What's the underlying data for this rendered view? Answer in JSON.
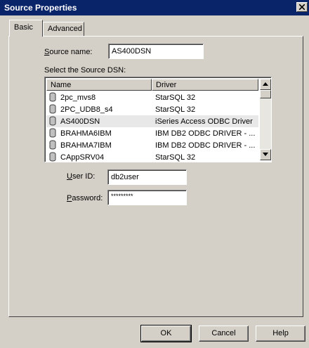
{
  "window": {
    "title": "Source Properties"
  },
  "tabs": [
    {
      "label": "Basic"
    },
    {
      "label": "Advanced"
    }
  ],
  "source_name": {
    "label_pre": "",
    "label_ul": "S",
    "label_post": "ource name:",
    "value": "AS400DSN"
  },
  "dsn_list": {
    "label": "Select the Source DSN:",
    "columns": [
      "Name",
      "Driver"
    ],
    "rows": [
      {
        "name": "2pc_mvs8",
        "driver": "StarSQL 32"
      },
      {
        "name": "2PC_UDB8_s4",
        "driver": "StarSQL 32"
      },
      {
        "name": "AS400DSN",
        "driver": "iSeries Access ODBC Driver"
      },
      {
        "name": "BRAHMA6IBM",
        "driver": "IBM DB2 ODBC DRIVER - ..."
      },
      {
        "name": "BRAHMA7IBM",
        "driver": "IBM DB2 ODBC DRIVER - ..."
      },
      {
        "name": "CAppSRV04",
        "driver": "StarSQL 32"
      }
    ]
  },
  "user_id": {
    "label_ul": "U",
    "label_post": "ser ID:",
    "value": "db2user"
  },
  "password": {
    "label_ul": "P",
    "label_post": "assword:",
    "value": "*********"
  },
  "buttons": {
    "ok": "OK",
    "cancel": "Cancel",
    "help": "Help"
  },
  "colors": {
    "titlebar": "#0a246a",
    "face": "#d4d0c8",
    "selected_row": "#e8e8e8"
  }
}
